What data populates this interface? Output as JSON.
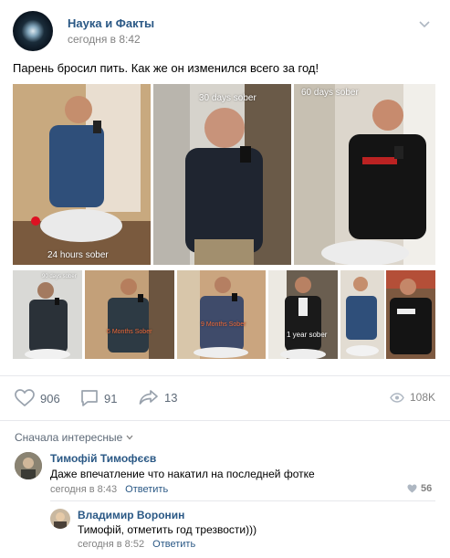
{
  "post": {
    "group_name": "Наука и Факты",
    "time": "сегодня в 8:42",
    "text": "Парень бросил пить. Как же он изменился всего за год!"
  },
  "photos": {
    "top": [
      {
        "caption": "24 hours sober"
      },
      {
        "caption": "30 days sober"
      },
      {
        "caption": "60 days sober"
      }
    ],
    "bottom": [
      {
        "caption": "90 days sober"
      },
      {
        "caption": "6 Months Sober"
      },
      {
        "caption": "9 Months Sober"
      },
      {
        "caption": "1 year sober"
      },
      {
        "caption": ""
      },
      {
        "caption": ""
      }
    ]
  },
  "actions": {
    "likes": "906",
    "comments": "91",
    "shares": "13",
    "views": "108K"
  },
  "comments_section": {
    "sort_label": "Сначала интересные"
  },
  "comments": [
    {
      "author": "Тимофій Тимофєєв",
      "text": "Даже впечатление что накатил на последней фотке",
      "time": "сегодня в 8:43",
      "reply_label": "Ответить",
      "likes": "56"
    },
    {
      "author": "Владимир Воронин",
      "text": "Тимофій, отметить год трезвости)))",
      "time": "сегодня в 8:52",
      "reply_label": "Ответить"
    }
  ],
  "icons": [
    "chevron-down-icon",
    "heart-icon",
    "comment-icon",
    "share-icon",
    "eye-icon"
  ],
  "colors": {
    "link": "#2a5885",
    "muted": "#828282",
    "action": "#5e6a78",
    "divider": "#e7e8ec"
  }
}
